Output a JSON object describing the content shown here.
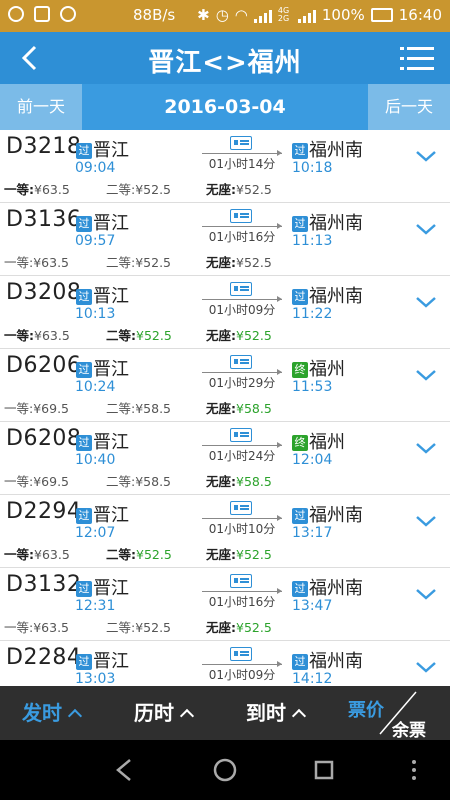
{
  "status_bar": {
    "speed": "88B/s",
    "battery": "100%",
    "time": "16:40",
    "network": "4G 2G"
  },
  "header": {
    "title": "晋江<>福州",
    "back_icon": "chevron-left-icon",
    "menu_icon": "list-menu-icon"
  },
  "date_bar": {
    "prev_label": "前一天",
    "date": "2016-03-04",
    "next_label": "后一天"
  },
  "trains": [
    {
      "number": "D3218",
      "dep_badge": "过",
      "from": "晋江",
      "dep_time": "09:04",
      "duration": "01小时14分",
      "arr_badge": "过",
      "to": "福州南",
      "arr_time": "10:18",
      "first_label": "一等:",
      "first_price": "¥63.5",
      "first_available": false,
      "first_bold": true,
      "second_label": "二等:",
      "second_price": "¥52.5",
      "second_available": false,
      "second_bold": false,
      "noseat_label": "无座:",
      "noseat_price": "¥52.5",
      "noseat_available": false
    },
    {
      "number": "D3136",
      "dep_badge": "过",
      "from": "晋江",
      "dep_time": "09:57",
      "duration": "01小时16分",
      "arr_badge": "过",
      "to": "福州南",
      "arr_time": "11:13",
      "first_label": "一等:",
      "first_price": "¥63.5",
      "first_available": false,
      "first_bold": false,
      "second_label": "二等:",
      "second_price": "¥52.5",
      "second_available": false,
      "second_bold": false,
      "noseat_label": "无座:",
      "noseat_price": "¥52.5",
      "noseat_available": false
    },
    {
      "number": "D3208",
      "dep_badge": "过",
      "from": "晋江",
      "dep_time": "10:13",
      "duration": "01小时09分",
      "arr_badge": "过",
      "to": "福州南",
      "arr_time": "11:22",
      "first_label": "一等:",
      "first_price": "¥63.5",
      "first_available": false,
      "first_bold": true,
      "second_label": "二等:",
      "second_price": "¥52.5",
      "second_available": true,
      "second_bold": true,
      "noseat_label": "无座:",
      "noseat_price": "¥52.5",
      "noseat_available": true
    },
    {
      "number": "D6206",
      "dep_badge": "过",
      "from": "晋江",
      "dep_time": "10:24",
      "duration": "01小时29分",
      "arr_badge": "终",
      "to": "福州",
      "arr_time": "11:53",
      "first_label": "一等:",
      "first_price": "¥69.5",
      "first_available": false,
      "first_bold": false,
      "second_label": "二等:",
      "second_price": "¥58.5",
      "second_available": false,
      "second_bold": false,
      "noseat_label": "无座:",
      "noseat_price": "¥58.5",
      "noseat_available": true
    },
    {
      "number": "D6208",
      "dep_badge": "过",
      "from": "晋江",
      "dep_time": "10:40",
      "duration": "01小时24分",
      "arr_badge": "终",
      "to": "福州",
      "arr_time": "12:04",
      "first_label": "一等:",
      "first_price": "¥69.5",
      "first_available": false,
      "first_bold": false,
      "second_label": "二等:",
      "second_price": "¥58.5",
      "second_available": false,
      "second_bold": false,
      "noseat_label": "无座:",
      "noseat_price": "¥58.5",
      "noseat_available": true
    },
    {
      "number": "D2294",
      "dep_badge": "过",
      "from": "晋江",
      "dep_time": "12:07",
      "duration": "01小时10分",
      "arr_badge": "过",
      "to": "福州南",
      "arr_time": "13:17",
      "first_label": "一等:",
      "first_price": "¥63.5",
      "first_available": false,
      "first_bold": true,
      "second_label": "二等:",
      "second_price": "¥52.5",
      "second_available": true,
      "second_bold": true,
      "noseat_label": "无座:",
      "noseat_price": "¥52.5",
      "noseat_available": true
    },
    {
      "number": "D3132",
      "dep_badge": "过",
      "from": "晋江",
      "dep_time": "12:31",
      "duration": "01小时16分",
      "arr_badge": "过",
      "to": "福州南",
      "arr_time": "13:47",
      "first_label": "一等:",
      "first_price": "¥63.5",
      "first_available": false,
      "first_bold": false,
      "second_label": "二等:",
      "second_price": "¥52.5",
      "second_available": false,
      "second_bold": false,
      "noseat_label": "无座:",
      "noseat_price": "¥52.5",
      "noseat_available": true
    },
    {
      "number": "D2284",
      "dep_badge": "过",
      "from": "晋江",
      "dep_time": "13:03",
      "duration": "01小时09分",
      "arr_badge": "过",
      "to": "福州南",
      "arr_time": "14:12",
      "first_label": "",
      "first_price": "",
      "first_available": false,
      "first_bold": false,
      "second_label": "",
      "second_price": "",
      "second_available": false,
      "second_bold": false,
      "noseat_label": "",
      "noseat_price": "",
      "noseat_available": false
    }
  ],
  "bottom_bar": {
    "tab_depart": "发时",
    "tab_duration": "历时",
    "tab_arrive": "到时",
    "tab_price": "票价",
    "tab_remaining": "余票",
    "active_color": "#3A9BE0"
  },
  "colors": {
    "status_bar": "#C9962F",
    "header": "#2E8FD6",
    "date_bar": "#3A9BE0",
    "date_buttons": "#7BBBE8",
    "available": "#2CA32C",
    "badge_pass": "#2E8FD6",
    "badge_end": "#2CA32C"
  }
}
